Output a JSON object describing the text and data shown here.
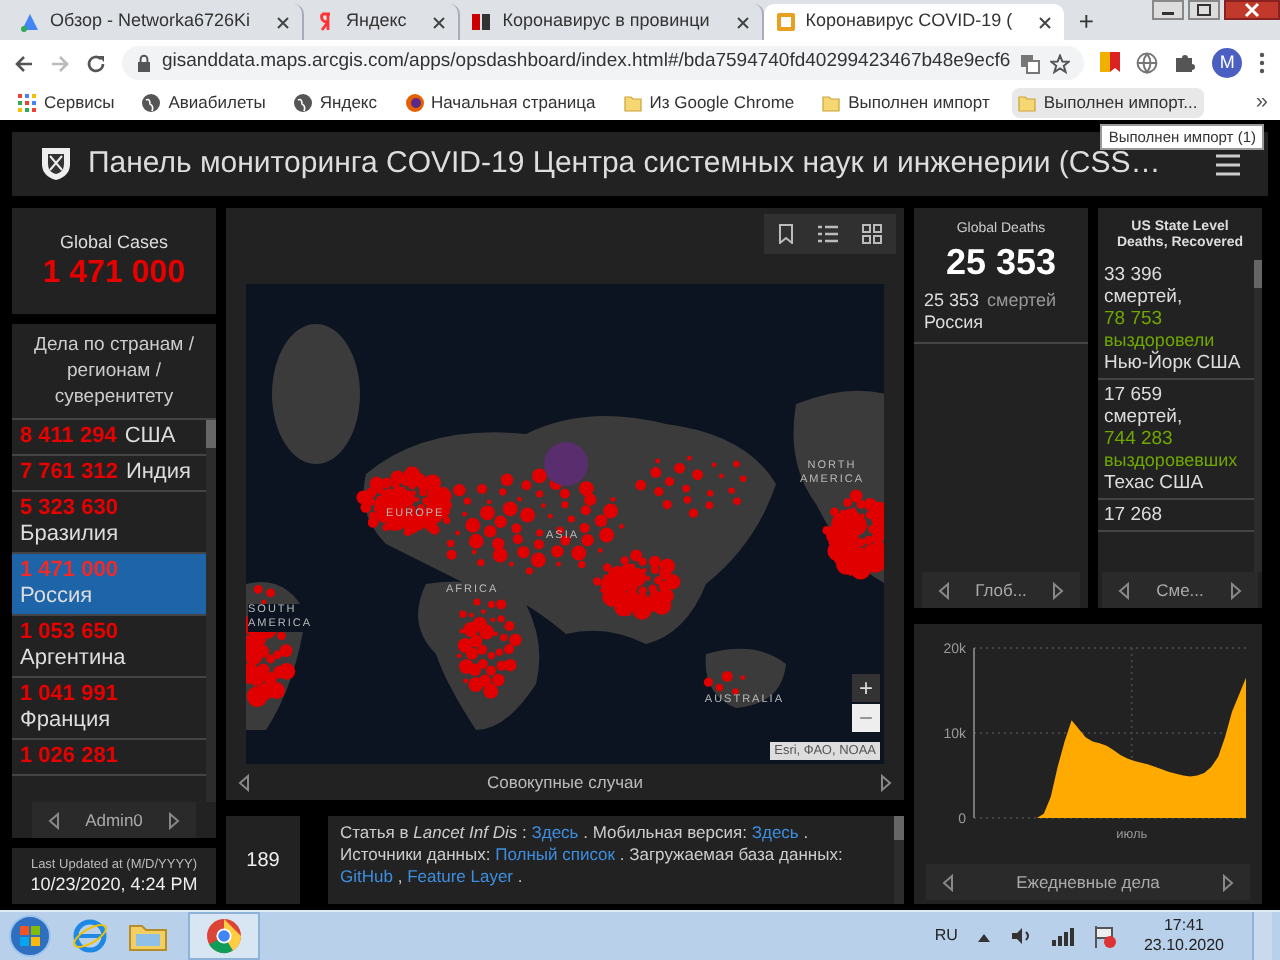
{
  "browser": {
    "tabs": [
      {
        "title": "Обзор - Networka6726Ki",
        "kind": "ads",
        "selected": false
      },
      {
        "title": "Яндекс",
        "kind": "yandex",
        "selected": false
      },
      {
        "title": "Коронавирус в провинци",
        "kind": "news",
        "selected": false
      },
      {
        "title": "Коронавирус COVID-19 (",
        "kind": "dashboard",
        "selected": true
      }
    ],
    "new_tab": "+",
    "url": "gisanddata.maps.arcgis.com/apps/opsdashboard/index.html#/bda7594740fd40299423467b48e9ecf6",
    "profile_initial": "M",
    "bookmarks": [
      {
        "label": "Сервисы",
        "kind": "apps",
        "hovered": false
      },
      {
        "label": "Авиабилеты",
        "kind": "globe",
        "hovered": false
      },
      {
        "label": "Яндекс",
        "kind": "globe",
        "hovered": false
      },
      {
        "label": "Начальная страница",
        "kind": "firefox",
        "hovered": false
      },
      {
        "label": "Из Google Chrome",
        "kind": "folder",
        "hovered": false
      },
      {
        "label": "Выполнен импорт",
        "kind": "folder",
        "hovered": false
      },
      {
        "label": "Выполнен импорт...",
        "kind": "folder",
        "hovered": true
      }
    ],
    "more": "»",
    "tooltip": "Выполнен импорт (1)"
  },
  "dashboard": {
    "title": "Панель мониторинга COVID-19 Центра системных наук и инженерии (CSS…"
  },
  "global_cases": {
    "label": "Global Cases",
    "value": "1 471 000"
  },
  "country_list": {
    "heading": "Дела по странам / регионам / суверенитету",
    "items": [
      {
        "value": "8 411 294",
        "name": "США",
        "selected": false
      },
      {
        "value": "7 761 312",
        "name": "Индия",
        "selected": false
      },
      {
        "value": "5 323 630",
        "name": "Бразилия",
        "selected": false
      },
      {
        "value": "1 471 000",
        "name": "Россия",
        "selected": true
      },
      {
        "value": "1 053 650",
        "name": "Аргентина",
        "selected": false
      },
      {
        "value": "1 041 991",
        "name": "Франция",
        "selected": false
      },
      {
        "value": "1 026 281",
        "selected": false
      }
    ],
    "nav_label": "Admin0"
  },
  "last_updated": {
    "label": "Last Updated at (M/D/YYYY)",
    "value": "10/23/2020, 4:24 PM"
  },
  "map": {
    "labels": [
      "EUROPE",
      "ASIA",
      "NORTH AMERICA",
      "AFRICA",
      "SOUTH AMERICA",
      "AUSTRALIA"
    ],
    "attribution": "Esri, ФАО, NOAA",
    "zoom_in": "+",
    "zoom_out": "−",
    "caption": "Совокупные случаи"
  },
  "count_box": {
    "value": "189"
  },
  "info": {
    "segments": [
      {
        "text": "Статья в *Lancet Inf Dis* :",
        "link": false
      },
      {
        "text": "Здесь",
        "link": true
      },
      {
        "text": ". Мобильная версия:",
        "link": false
      },
      {
        "text": "Здесь",
        "link": true
      },
      {
        "text": ". Источники данных:",
        "link": false
      },
      {
        "text": "Полный список",
        "link": true
      },
      {
        "text": ". Загружаемая база данных:",
        "link": false
      },
      {
        "text": "GitHub",
        "link": true
      },
      {
        "text": ",",
        "link": false
      },
      {
        "text": "Feature Layer",
        "link": true
      },
      {
        "text": ".",
        "link": false
      }
    ]
  },
  "global_deaths": {
    "label": "Global Deaths",
    "value": "25 353",
    "items": [
      {
        "value": "25 353",
        "unit": "смертей",
        "place": "Россия"
      }
    ],
    "nav_label": "Глоб..."
  },
  "us_states": {
    "title": "US State Level",
    "subtitle": "Deaths, Recovered",
    "items": [
      {
        "deaths": "33 396",
        "unit": "смертей,",
        "recovered": "78 753",
        "recovered_label": "выздоровели",
        "place": "Нью-Йорк США"
      },
      {
        "deaths": "17 659",
        "unit": "смертей,",
        "recovered": "744 283",
        "recovered_label": "выздоровевших",
        "place": "Техас США"
      },
      {
        "deaths": "17 268"
      }
    ],
    "nav_label": "Сме..."
  },
  "daily_chart": {
    "chart_data": {
      "type": "area",
      "title": "Ежедневные дела",
      "series": [
        {
          "color": "#ffaa00",
          "values": [
            0,
            0,
            0,
            0,
            0,
            0,
            0,
            0,
            0,
            0,
            500,
            2500,
            6000,
            9000,
            11500,
            10500,
            9500,
            9000,
            8800,
            8500,
            8000,
            7400,
            7000,
            6700,
            6500,
            6300,
            6000,
            5700,
            5400,
            5200,
            5000,
            4900,
            5000,
            5300,
            6000,
            7200,
            9500,
            12500,
            14500,
            16500
          ]
        }
      ],
      "ylim": [
        0,
        20000
      ],
      "yticks": [
        {
          "value": 0,
          "label": "0"
        },
        {
          "value": 10000,
          "label": "10k"
        },
        {
          "value": 20000,
          "label": "20k"
        }
      ],
      "annotations": [
        "июль"
      ]
    }
  },
  "taskbar": {
    "language": "RU",
    "time": "17:41",
    "date": "23.10.2020"
  }
}
